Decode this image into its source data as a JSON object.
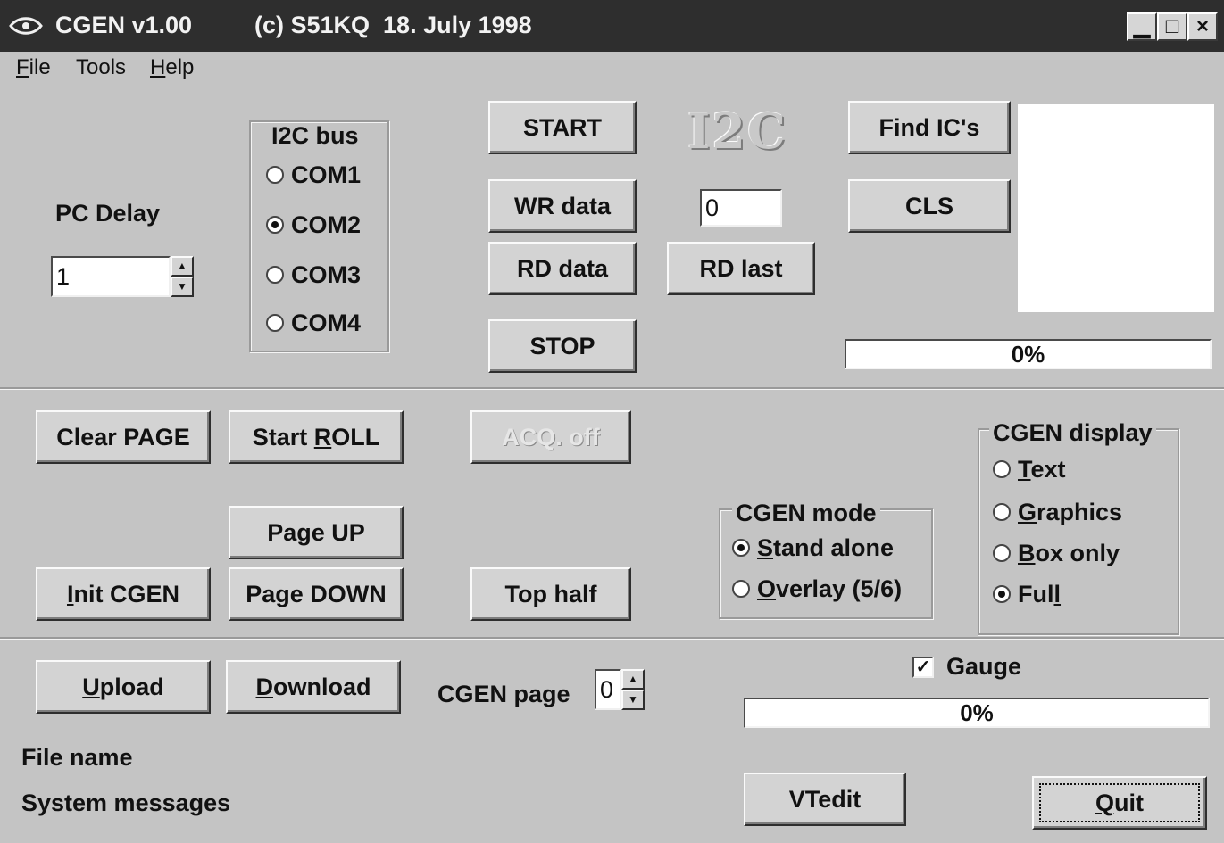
{
  "window": {
    "title_app": "CGEN v1.00",
    "title_info": "(c) S51KQ  18. July 1998",
    "min_glyph": "▁",
    "max_glyph": "□",
    "close_glyph": "×"
  },
  "menu": {
    "file": "File",
    "tools": "Tools",
    "help": "Help"
  },
  "i2c_bus": {
    "title": "I2C bus",
    "options": [
      "COM1",
      "COM2",
      "COM3",
      "COM4"
    ],
    "selected": "COM2"
  },
  "pc_delay": {
    "label": "PC Delay",
    "value": "1"
  },
  "i2c_controls": {
    "start": "START",
    "wr_data": "WR data",
    "data_value": "0",
    "rd_data": "RD data",
    "rd_last": "RD last",
    "stop": "STOP",
    "logo": "I2C"
  },
  "find": {
    "find_ics": "Find IC's",
    "cls": "CLS",
    "progress": "0%"
  },
  "page_controls": {
    "clear_page": "Clear PAGE",
    "start_roll": "Start ROLL",
    "acq_off": "ACQ. off",
    "page_up": "Page UP",
    "init_cgen": "Init CGEN",
    "page_down": "Page DOWN",
    "top_half": "Top half"
  },
  "cgen_mode": {
    "title": "CGEN mode",
    "options": [
      "Stand alone",
      "Overlay (5/6)"
    ],
    "selected": "Stand alone"
  },
  "cgen_display": {
    "title": "CGEN display",
    "options": [
      "Text",
      "Graphics",
      "Box only",
      "Full"
    ],
    "selected": "Full"
  },
  "transfer": {
    "upload": "Upload",
    "download": "Download",
    "cgen_page_label": "CGEN page",
    "cgen_page_value": "0",
    "gauge_label": "Gauge",
    "gauge_checked": true,
    "gauge_progress": "0%"
  },
  "status": {
    "file_name": "File name",
    "system_messages": "System messages",
    "vtedit": "VTedit",
    "quit": "Quit"
  }
}
